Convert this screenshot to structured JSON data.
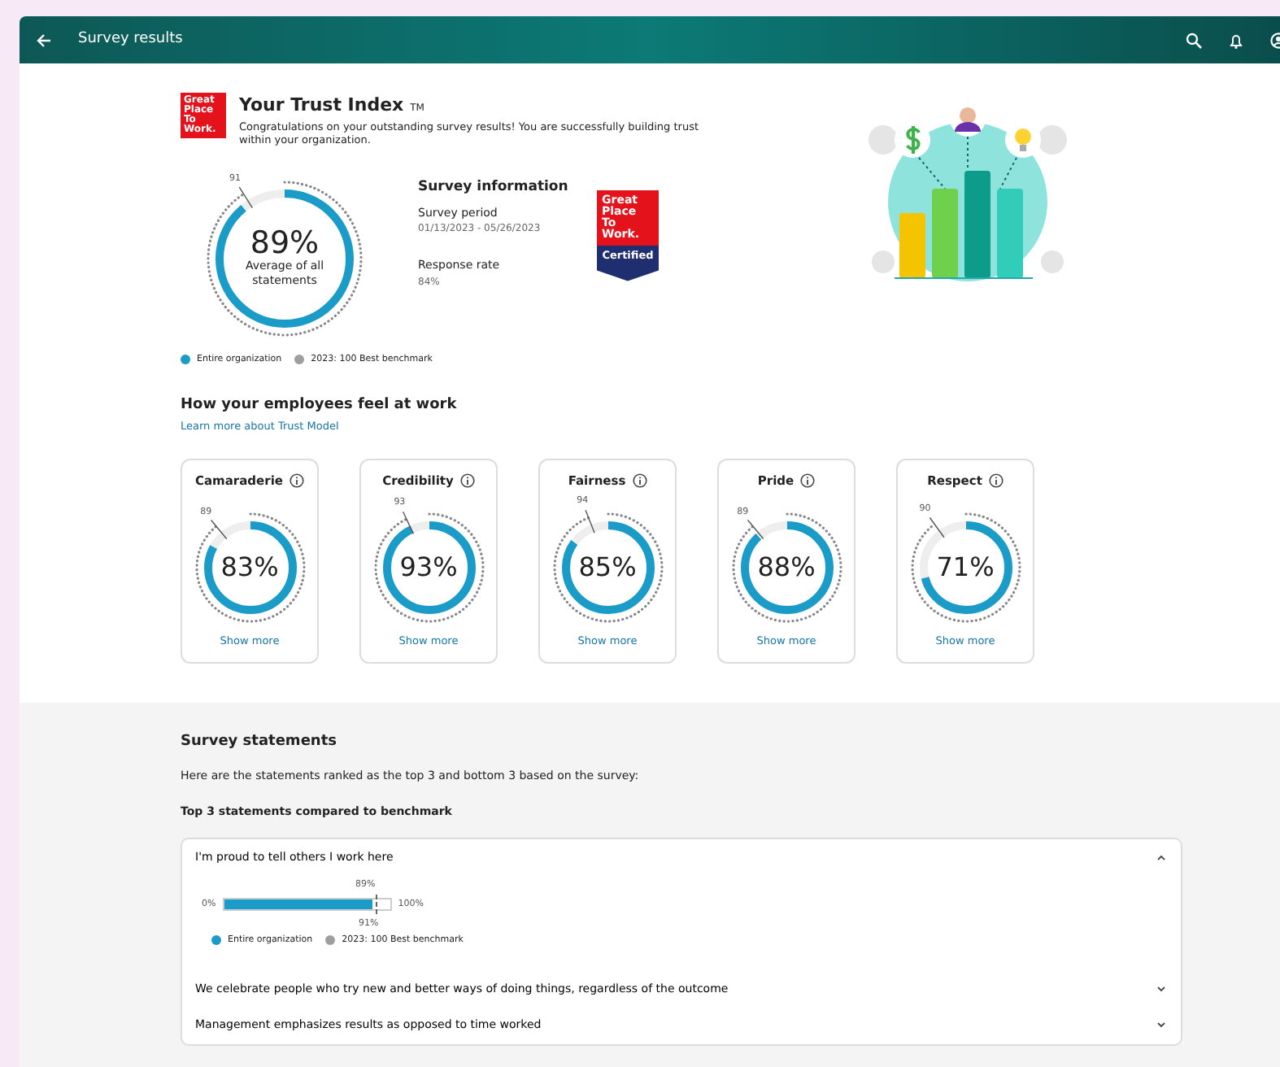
{
  "app_bar": {
    "title": "Survey results"
  },
  "trust_index": {
    "logo_text": "Great Place To Work.",
    "title": "Your Trust Index",
    "trademark": "TM",
    "message": "Congratulations on your outstanding survey results! You are successfully building trust within your organization.",
    "gauge": {
      "value": "89%",
      "caption": "Average of all statements",
      "benchmark": "91",
      "level": 0.89
    },
    "survey_info": {
      "title": "Survey information",
      "fields": [
        {
          "label": "Survey period",
          "value": "01/13/2023 - 05/26/2023"
        },
        {
          "label": "Response rate",
          "value": "84%"
        }
      ]
    },
    "badge": {
      "top_text": "Great Place To Work.",
      "bottom_text": "Certified"
    },
    "legend": [
      {
        "label": "Entire organization",
        "color": "#1a9bc8"
      },
      {
        "label": "2023: 100 Best benchmark",
        "color": "#9e9e9e"
      }
    ]
  },
  "dimensions": {
    "title": "How your employees feel at work",
    "link": "Learn more about Trust Model",
    "cards": [
      {
        "name": "Camaraderie",
        "value": "83%",
        "benchmark": "89",
        "level": 0.83,
        "action": "Show more"
      },
      {
        "name": "Credibility",
        "value": "93%",
        "benchmark": "93",
        "level": 0.93,
        "action": "Show more"
      },
      {
        "name": "Fairness",
        "value": "85%",
        "benchmark": "94",
        "level": 0.85,
        "action": "Show more"
      },
      {
        "name": "Pride",
        "value": "88%",
        "benchmark": "89",
        "level": 0.88,
        "action": "Show more"
      },
      {
        "name": "Respect",
        "value": "71%",
        "benchmark": "90",
        "level": 0.71,
        "action": "Show more"
      }
    ]
  },
  "statements": {
    "title": "Survey statements",
    "intro": "Here are the statements ranked as the top 3 and bottom 3 based on the survey:",
    "subtitle": "Top 3 statements compared to benchmark",
    "items": [
      {
        "text": "I'm proud to tell others I work here",
        "expanded": true,
        "bar": {
          "min_label": "0%",
          "max_label": "100%",
          "value_label": "89%",
          "benchmark_label": "91%",
          "level": 0.89
        },
        "legend": [
          {
            "label": "Entire organization",
            "color": "#1a9bc8"
          },
          {
            "label": "2023: 100 Best benchmark",
            "color": "#9e9e9e"
          }
        ]
      },
      {
        "text": "We celebrate people who try new and better ways of doing things, regardless of the outcome",
        "expanded": false
      },
      {
        "text": "Management emphasizes results as opposed to time worked",
        "expanded": false
      }
    ]
  }
}
